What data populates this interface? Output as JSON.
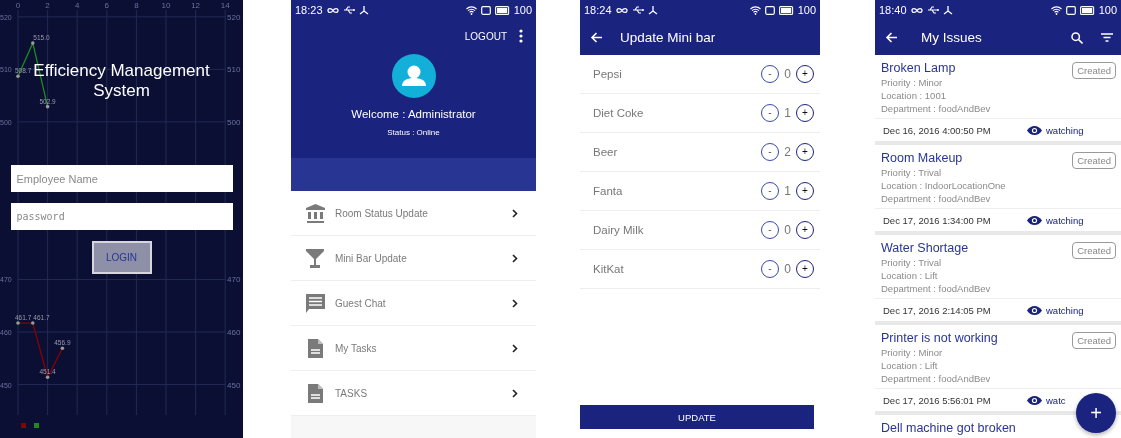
{
  "login_screen": {
    "title": "Efficiency Management System",
    "employee_field": {
      "placeholder": "Employee Name"
    },
    "password_field": {
      "placeholder": "password"
    },
    "login_button": "LOGIN",
    "chart_data": {
      "type": "line",
      "x": [
        0,
        1,
        2,
        3
      ],
      "series": [
        {
          "color": "#8b0000",
          "values": [
            461.7,
            461.7,
            451.4,
            456.9
          ],
          "value_labels": [
            "461.7",
            "461.7",
            "451.4",
            "456.9"
          ]
        },
        {
          "color": "#1e8a1e",
          "values": [
            508.7,
            515.0,
            502.9,
            null
          ],
          "value_labels": [
            "508.7",
            "515.0",
            "502.9",
            null
          ]
        }
      ],
      "xlim": [
        0,
        14
      ],
      "ylim": [
        444.2,
        521.3
      ],
      "xticks": [
        0,
        2,
        4,
        6,
        8,
        10,
        12,
        14
      ],
      "yticks": [
        450,
        460,
        470,
        500,
        510,
        520
      ],
      "grid": true,
      "annotations": [
        "450",
        "460",
        "470",
        "500",
        "510",
        "520"
      ]
    }
  },
  "dashboard": {
    "status_bar": {
      "time": "18:23",
      "battery": "100"
    },
    "logout": "LOGOUT",
    "welcome": "Welcome : Administrator",
    "status": "Status : Online",
    "menu": [
      {
        "label": "Room Status Update",
        "kind": "building"
      },
      {
        "label": "Mini Bar Update",
        "kind": "glass"
      },
      {
        "label": "Guest Chat",
        "kind": "chat"
      },
      {
        "label": "My Tasks",
        "kind": "document"
      },
      {
        "label": "TASKS",
        "kind": "document"
      }
    ]
  },
  "minibar": {
    "status_bar": {
      "time": "18:24",
      "battery": "100"
    },
    "title": "Update Mini bar",
    "decrement_label": "-",
    "increment_label": "+",
    "items": [
      {
        "name": "Pepsi",
        "count": "0"
      },
      {
        "name": "Diet Coke",
        "count": "1"
      },
      {
        "name": "Beer",
        "count": "2"
      },
      {
        "name": "Fanta",
        "count": "1"
      },
      {
        "name": "Dairy Milk",
        "count": "0"
      },
      {
        "name": "KitKat",
        "count": "0"
      }
    ],
    "update_button": "UPDATE"
  },
  "issues": {
    "status_bar": {
      "time": "18:40",
      "battery": "100"
    },
    "title": "My Issues",
    "fab_label": "+",
    "items": [
      {
        "title": "Broken Lamp",
        "priority": "Priority : Minor",
        "location": "Location : 1001",
        "department": "Department : foodAndBev",
        "status": "Created",
        "date": "Dec 16, 2016 4:00:50 PM",
        "watch": "watching"
      },
      {
        "title": "Room Makeup",
        "priority": "Priority : Trival",
        "location": "Location : IndoorLocationOne",
        "department": "Department : foodAndBev",
        "status": "Created",
        "date": "Dec 17, 2016 1:34:00 PM",
        "watch": "watching"
      },
      {
        "title": "Water Shortage",
        "priority": "Priority : Trival",
        "location": "Location : Lift",
        "department": "Department : foodAndBev",
        "status": "Created",
        "date": "Dec 17, 2016 2:14:05 PM",
        "watch": "watching"
      },
      {
        "title": "Printer is not working",
        "priority": "Priority : Minor",
        "location": "Location : Lift",
        "department": "Department : foodAndBev",
        "status": "Created",
        "date": "Dec 17, 2016 5:56:01 PM",
        "watch": "watc"
      },
      {
        "title": "Dell machine got broken"
      }
    ]
  }
}
